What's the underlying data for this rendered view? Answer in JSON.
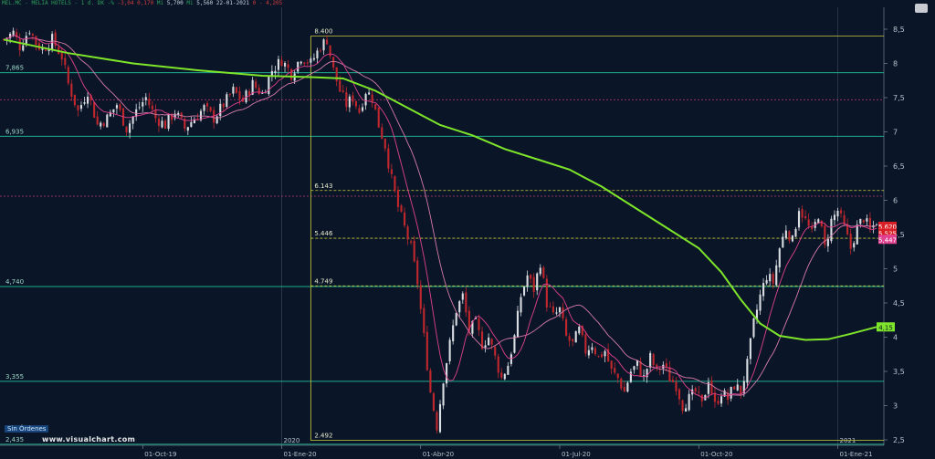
{
  "header": {
    "symbol": "MEL.MC - MELIA HOTELS - 1 d. DK -%",
    "change": "-3,04",
    "change_abs": "0,170",
    "high_label": "Mi",
    "high": "5,700",
    "low_label": "Mi",
    "low": "5,560",
    "date": "22-01-2021",
    "extra": "0 - 4,205"
  },
  "watermark": "www.visualchart.com",
  "orders_label": "Sin Órdenes",
  "colors": {
    "background": "#0a1628",
    "up_candle": "#d9dde2",
    "down_candle": "#c0272d",
    "sma_long": "#7ee52a",
    "ma_fast": "#e0408f",
    "ma_slow": "#d67aa8",
    "support_line": "#1fae8c",
    "fib_line": "#c8cd3a",
    "resistance_dotted": "#c23a78"
  },
  "chart_data": {
    "type": "candlestick",
    "x_tick_labels": [
      "01-Oct-19",
      "01-Ene-20",
      "01-Abr-20",
      "01-Jul-20",
      "01-Oct-20",
      "01-Ene-21"
    ],
    "x_year_labels": [
      "2020",
      "2021"
    ],
    "y_tick_labels": [
      "2,5",
      "3",
      "3,5",
      "4",
      "4,5",
      "5",
      "5,5",
      "6",
      "6,5",
      "7",
      "7,5",
      "8",
      "8,5"
    ],
    "ylim": [
      2.42,
      8.82
    ],
    "horizontal_levels": [
      {
        "value": 7.865,
        "label": "7,865",
        "style": "solid-teal"
      },
      {
        "value": 6.935,
        "label": "6,935",
        "style": "solid-teal"
      },
      {
        "value": 4.74,
        "label": "4,740",
        "style": "solid-teal"
      },
      {
        "value": 3.355,
        "label": "3,355",
        "style": "solid-teal"
      },
      {
        "value": 2.435,
        "label": "2,435",
        "style": "solid-teal"
      },
      {
        "value": 7.47,
        "label": "",
        "style": "dotted-magenta"
      },
      {
        "value": 6.06,
        "label": "",
        "style": "dotted-magenta"
      }
    ],
    "fibonacci": [
      {
        "value": 8.4,
        "label": "8.400"
      },
      {
        "value": 6.143,
        "label": "6.143"
      },
      {
        "value": 5.446,
        "label": "5.446"
      },
      {
        "value": 4.749,
        "label": "4.749"
      },
      {
        "value": 2.492,
        "label": "2.492"
      }
    ],
    "price_badges": [
      {
        "label": "5,620",
        "value": 5.62,
        "color": "#d81f26"
      },
      {
        "label": "5,525",
        "value": 5.52,
        "color": "#d81f26"
      },
      {
        "label": "5,447",
        "value": 5.43,
        "color": "#e0408f"
      },
      {
        "label": "4,15",
        "value": 4.15,
        "color": "#7ee52a"
      }
    ],
    "path_points": [
      [
        0,
        8.35
      ],
      [
        3,
        8.45
      ],
      [
        5,
        8.25
      ],
      [
        8,
        8.5
      ],
      [
        10,
        8.3
      ],
      [
        12,
        8.2
      ],
      [
        15,
        8.35
      ],
      [
        18,
        8.1
      ],
      [
        20,
        7.7
      ],
      [
        23,
        7.3
      ],
      [
        26,
        7.6
      ],
      [
        29,
        7.1
      ],
      [
        32,
        7.2
      ],
      [
        35,
        7.4
      ],
      [
        38,
        7.05
      ],
      [
        41,
        7.3
      ],
      [
        44,
        7.5
      ],
      [
        47,
        7.2
      ],
      [
        50,
        7.1
      ],
      [
        53,
        7.3
      ],
      [
        56,
        7.05
      ],
      [
        59,
        7.2
      ],
      [
        62,
        7.35
      ],
      [
        65,
        7.2
      ],
      [
        68,
        7.4
      ],
      [
        71,
        7.6
      ],
      [
        74,
        7.45
      ],
      [
        77,
        7.7
      ],
      [
        80,
        7.55
      ],
      [
        83,
        7.9
      ],
      [
        86,
        8.05
      ],
      [
        89,
        7.85
      ],
      [
        92,
        8.1
      ],
      [
        95,
        8.0
      ],
      [
        98,
        8.25
      ],
      [
        100,
        8.35
      ],
      [
        102,
        7.9
      ],
      [
        104,
        7.6
      ],
      [
        106,
        7.4
      ],
      [
        108,
        7.5
      ],
      [
        110,
        7.3
      ],
      [
        112,
        7.6
      ],
      [
        114,
        7.5
      ],
      [
        116,
        7.1
      ],
      [
        118,
        6.8
      ],
      [
        120,
        6.3
      ],
      [
        122,
        5.9
      ],
      [
        124,
        5.6
      ],
      [
        126,
        5.3
      ],
      [
        128,
        4.8
      ],
      [
        130,
        4.0
      ],
      [
        132,
        3.2
      ],
      [
        134,
        2.7
      ],
      [
        136,
        3.4
      ],
      [
        138,
        3.9
      ],
      [
        140,
        4.4
      ],
      [
        142,
        4.6
      ],
      [
        144,
        4.1
      ],
      [
        146,
        4.2
      ],
      [
        148,
        3.9
      ],
      [
        150,
        4.0
      ],
      [
        152,
        3.7
      ],
      [
        154,
        3.4
      ],
      [
        156,
        3.6
      ],
      [
        158,
        4.0
      ],
      [
        160,
        4.6
      ],
      [
        162,
        4.9
      ],
      [
        164,
        4.7
      ],
      [
        166,
        5.1
      ],
      [
        168,
        4.5
      ],
      [
        170,
        4.3
      ],
      [
        172,
        4.4
      ],
      [
        174,
        4.0
      ],
      [
        176,
        3.9
      ],
      [
        178,
        4.1
      ],
      [
        180,
        3.8
      ],
      [
        182,
        3.9
      ],
      [
        184,
        3.7
      ],
      [
        186,
        3.8
      ],
      [
        188,
        3.5
      ],
      [
        190,
        3.4
      ],
      [
        192,
        3.2
      ],
      [
        194,
        3.5
      ],
      [
        196,
        3.6
      ],
      [
        198,
        3.4
      ],
      [
        200,
        3.7
      ],
      [
        202,
        3.5
      ],
      [
        204,
        3.6
      ],
      [
        206,
        3.4
      ],
      [
        208,
        3.3
      ],
      [
        210,
        3.0
      ],
      [
        212,
        3.1
      ],
      [
        214,
        3.2
      ],
      [
        216,
        3.0
      ],
      [
        218,
        3.4
      ],
      [
        220,
        3.0
      ],
      [
        222,
        3.2
      ],
      [
        224,
        3.1
      ],
      [
        226,
        3.3
      ],
      [
        228,
        3.2
      ],
      [
        230,
        3.6
      ],
      [
        232,
        4.2
      ],
      [
        234,
        4.6
      ],
      [
        236,
        4.9
      ],
      [
        238,
        4.8
      ],
      [
        240,
        5.3
      ],
      [
        242,
        5.6
      ],
      [
        244,
        5.4
      ],
      [
        246,
        5.9
      ],
      [
        248,
        5.7
      ],
      [
        250,
        5.5
      ],
      [
        252,
        5.8
      ],
      [
        254,
        5.3
      ],
      [
        256,
        5.7
      ],
      [
        258,
        5.85
      ],
      [
        260,
        5.6
      ],
      [
        262,
        5.3
      ],
      [
        264,
        5.6
      ],
      [
        266,
        5.75
      ],
      [
        268,
        5.55
      ],
      [
        270,
        5.7
      ]
    ],
    "sma_long_points": [
      [
        0,
        8.35
      ],
      [
        20,
        8.15
      ],
      [
        40,
        8.0
      ],
      [
        60,
        7.9
      ],
      [
        80,
        7.82
      ],
      [
        95,
        7.8
      ],
      [
        105,
        7.78
      ],
      [
        115,
        7.6
      ],
      [
        125,
        7.35
      ],
      [
        135,
        7.1
      ],
      [
        145,
        6.95
      ],
      [
        155,
        6.75
      ],
      [
        165,
        6.6
      ],
      [
        175,
        6.45
      ],
      [
        185,
        6.2
      ],
      [
        195,
        5.9
      ],
      [
        205,
        5.6
      ],
      [
        215,
        5.3
      ],
      [
        222,
        4.95
      ],
      [
        228,
        4.55
      ],
      [
        234,
        4.2
      ],
      [
        240,
        4.02
      ],
      [
        248,
        3.96
      ],
      [
        255,
        3.97
      ],
      [
        262,
        4.05
      ],
      [
        270,
        4.15
      ]
    ],
    "total_bars": 271,
    "x_tick_positions": [
      43,
      86,
      129,
      172,
      215,
      258
    ],
    "year_positions": [
      86,
      258
    ],
    "fib_start_bar": 95
  }
}
